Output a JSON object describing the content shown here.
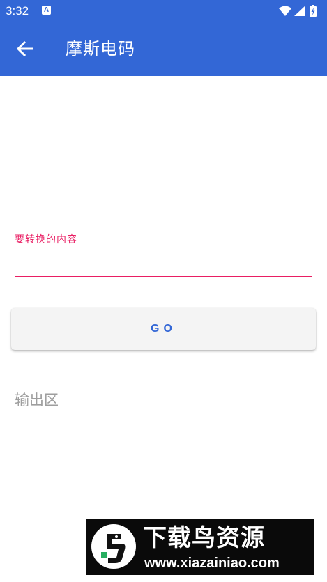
{
  "status_bar": {
    "time": "3:32",
    "notification_icon_letter": "A",
    "icons": [
      "a-notification-icon",
      "wifi-icon",
      "signal-icon",
      "battery-icon"
    ]
  },
  "app_bar": {
    "title": "摩斯电码",
    "back_icon": "arrow-left-icon",
    "background_color": "#3367d6"
  },
  "form": {
    "input_label": "要转换的内容",
    "input_value": "",
    "accent_color": "#e91e63",
    "go_label": "GO"
  },
  "output": {
    "text": "输出区"
  },
  "watermark": {
    "title": "下载鸟资源",
    "url": "www.xiazainiao.com"
  }
}
